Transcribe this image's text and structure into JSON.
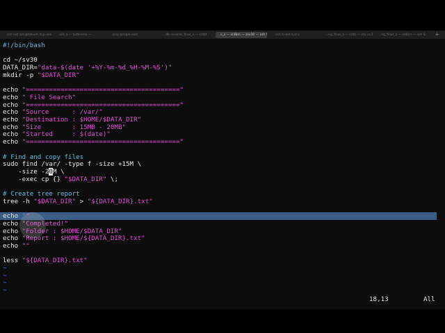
{
  "tabs": [
    {
      "label": "...ssh kat.sim@tdeum.dup.uskat..."
    },
    {
      "label": "...UX_a — tuttineno — ..."
    },
    {
      "label": "...png google.com"
    },
    {
      "label": "...db records_final_a — srdkt"
    },
    {
      "label": "...s_z — srdbm — zsv30 — ssh SRUNBORA",
      "active": true
    },
    {
      "label": "...ssh ticket-tyd.x"
    },
    {
      "label": "...ng_final_a — srdb — zsv ac30.sh"
    },
    {
      "label": "...ng_final_a — srdbm — ssh SRUNBORA"
    }
  ],
  "new_tab": "+",
  "lines": [
    {
      "segments": [
        {
          "t": "#!/bin/bash",
          "c": "sh"
        }
      ]
    },
    {
      "segments": []
    },
    {
      "segments": [
        {
          "t": "cd ~/sv30",
          "c": "kw"
        }
      ]
    },
    {
      "segments": [
        {
          "t": "DATA_DIR=",
          "c": "kw"
        },
        {
          "t": "\"data-$(date '+%Y-%m-%d_%H-%M-%S')\"",
          "c": "str"
        }
      ]
    },
    {
      "segments": [
        {
          "t": "mkdir -p ",
          "c": "kw"
        },
        {
          "t": "\"$DATA_DIR\"",
          "c": "str"
        }
      ]
    },
    {
      "segments": []
    },
    {
      "segments": [
        {
          "t": "echo ",
          "c": "kw"
        },
        {
          "t": "\"========================================\"",
          "c": "str"
        }
      ]
    },
    {
      "segments": [
        {
          "t": "echo ",
          "c": "kw"
        },
        {
          "t": "\" File Search\"",
          "c": "str"
        }
      ]
    },
    {
      "segments": [
        {
          "t": "echo ",
          "c": "kw"
        },
        {
          "t": "\"========================================\"",
          "c": "str"
        }
      ]
    },
    {
      "segments": [
        {
          "t": "echo ",
          "c": "kw"
        },
        {
          "t": "\"Source      : /var/\"",
          "c": "str"
        }
      ]
    },
    {
      "segments": [
        {
          "t": "echo ",
          "c": "kw"
        },
        {
          "t": "\"Destination : $HOME/$DATA_DIR\"",
          "c": "str"
        }
      ]
    },
    {
      "segments": [
        {
          "t": "echo ",
          "c": "kw"
        },
        {
          "t": "\"Size        : 15MB - 20MB\"",
          "c": "str"
        }
      ]
    },
    {
      "segments": [
        {
          "t": "echo ",
          "c": "kw"
        },
        {
          "t": "\"Started     : $(date)\"",
          "c": "str"
        }
      ]
    },
    {
      "segments": [
        {
          "t": "echo ",
          "c": "kw"
        },
        {
          "t": "\"========================================\"",
          "c": "str"
        }
      ]
    },
    {
      "segments": []
    },
    {
      "segments": [
        {
          "t": "# Find and copy files",
          "c": "cm"
        }
      ]
    },
    {
      "segments": [
        {
          "t": "sudo find /var/ -type f -size +15M \\",
          "c": "kw"
        }
      ]
    },
    {
      "segments": [
        {
          "t": "    -size -2",
          "c": "kw"
        },
        {
          "t": "0",
          "c": "cursor"
        },
        {
          "t": "M \\",
          "c": "kw"
        }
      ]
    },
    {
      "segments": [
        {
          "t": "    -exec cp {} ",
          "c": "kw"
        },
        {
          "t": "\"$DATA_DIR\"",
          "c": "str"
        },
        {
          "t": " \\;",
          "c": "kw"
        }
      ]
    },
    {
      "segments": []
    },
    {
      "segments": [
        {
          "t": "# Create tree report",
          "c": "cm"
        }
      ]
    },
    {
      "segments": [
        {
          "t": "tree -h ",
          "c": "kw"
        },
        {
          "t": "\"$DATA_DIR\"",
          "c": "str"
        },
        {
          "t": " > ",
          "c": "kw"
        },
        {
          "t": "\"${DATA_DIR}.txt\"",
          "c": "str"
        }
      ]
    },
    {
      "segments": []
    },
    {
      "segments": [
        {
          "t": "echo ",
          "c": "kw"
        },
        {
          "t": "\"\"",
          "c": "str"
        }
      ],
      "highlight": true
    },
    {
      "segments": [
        {
          "t": "echo ",
          "c": "kw"
        },
        {
          "t": "\"Completed!\"",
          "c": "str"
        }
      ]
    },
    {
      "segments": [
        {
          "t": "echo ",
          "c": "kw"
        },
        {
          "t": "\"Folder : $HOME/$DATA_DIR\"",
          "c": "str"
        }
      ]
    },
    {
      "segments": [
        {
          "t": "echo ",
          "c": "kw"
        },
        {
          "t": "\"Report : $HOME/${DATA_DIR}.txt\"",
          "c": "str"
        }
      ]
    },
    {
      "segments": [
        {
          "t": "echo ",
          "c": "kw"
        },
        {
          "t": "\"\"",
          "c": "str"
        }
      ]
    },
    {
      "segments": []
    },
    {
      "segments": [
        {
          "t": "less ",
          "c": "kw"
        },
        {
          "t": "\"${DATA_DIR}.txt\"",
          "c": "str"
        }
      ]
    },
    {
      "segments": [
        {
          "t": "~",
          "c": "tilde"
        }
      ]
    },
    {
      "segments": [
        {
          "t": "~",
          "c": "tilde"
        }
      ]
    },
    {
      "segments": [
        {
          "t": "~",
          "c": "tilde"
        }
      ]
    },
    {
      "segments": [
        {
          "t": "~",
          "c": "tilde"
        }
      ]
    }
  ],
  "status": {
    "position": "18,13",
    "scroll": "All"
  }
}
